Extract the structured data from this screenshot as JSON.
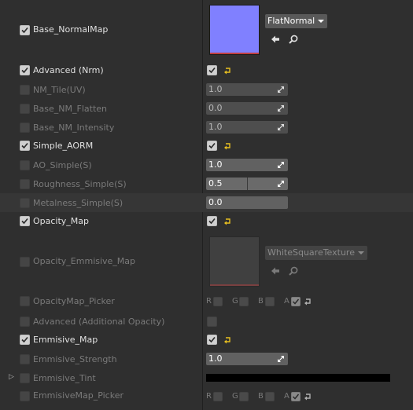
{
  "rows": [
    {
      "label": "Base_NormalMap",
      "checked": true
    },
    {
      "label": "Advanced (Nrm)",
      "checked": true
    },
    {
      "label": "NM_Tile(UV)",
      "checked": false,
      "value": "1.0"
    },
    {
      "label": "Base_NM_Flatten",
      "checked": false,
      "value": "0.0"
    },
    {
      "label": "Base_NM_Intensity",
      "checked": false,
      "value": "1.0"
    },
    {
      "label": "Simple_AORM",
      "checked": true
    },
    {
      "label": "AO_Simple(S)",
      "checked": false,
      "value": "1.0"
    },
    {
      "label": "Roughness_Simple(S)",
      "checked": false,
      "value": "0.5"
    },
    {
      "label": "Metalness_Simple(S)",
      "checked": false,
      "value": "0.0"
    },
    {
      "label": "Opacity_Map",
      "checked": true
    },
    {
      "label": "Opacity_Emmisive_Map",
      "checked": false
    },
    {
      "label": "OpacityMap_Picker",
      "checked": false
    },
    {
      "label": "Advanced (Additional Opacity)",
      "checked": false
    },
    {
      "label": "Emmisive_Map",
      "checked": true
    },
    {
      "label": "Emmisive_Strength",
      "checked": false,
      "value": "1.0"
    },
    {
      "label": "Emmisive_Tint",
      "checked": false
    },
    {
      "label": "EmmisiveMap_Picker",
      "checked": false
    }
  ],
  "textures": {
    "normal": {
      "name": "FlatNormal",
      "color": "#8080ff"
    },
    "opacity": {
      "name": "WhiteSquareTexture",
      "color": "#404040"
    }
  },
  "channels": {
    "r": "R",
    "g": "G",
    "b": "B",
    "a": "A"
  },
  "icons": {
    "checkmark": "checkmark-icon",
    "reset": "reset-arrow-icon",
    "back": "back-arrow-icon",
    "search": "search-icon",
    "dropdown": "chevron-down-icon",
    "drag": "drag-arrows-icon",
    "expand": "expand-triangle-icon"
  },
  "colors": {
    "emissive_tint": "#000000"
  }
}
